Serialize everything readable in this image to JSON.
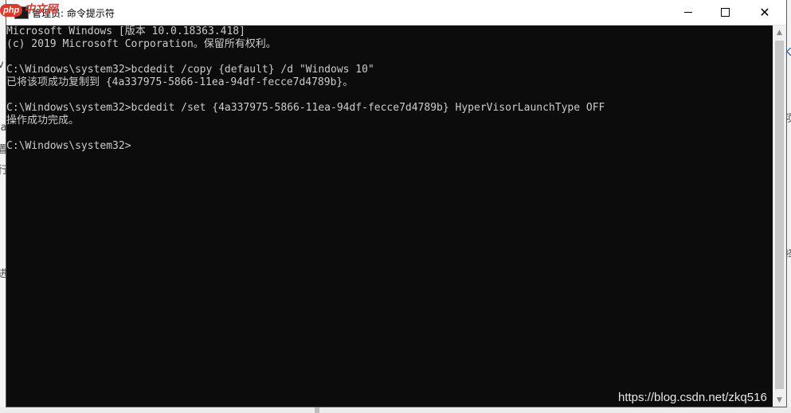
{
  "window": {
    "title": "管理员: 命令提示符",
    "badge_logo_text": "php",
    "badge_text": "中文网"
  },
  "controls": {
    "minimize_icon": "minimize-icon",
    "maximize_icon": "maximize-icon",
    "close_icon": "close-icon"
  },
  "console": {
    "lines": [
      "Microsoft Windows [版本 10.0.18363.418]",
      "(c) 2019 Microsoft Corporation。保留所有权利。",
      "",
      "C:\\Windows\\system32>bcdedit /copy {default} /d \"Windows 10\"",
      "已将该项成功复制到 {4a337975-5866-11ea-94df-fecce7d4789b}。",
      "",
      "C:\\Windows\\system32>bcdedit /set {4a337975-5866-11ea-94df-fecce7d4789b} HyperVisorLaunchType OFF",
      "操作成功完成。",
      "",
      "C:\\Windows\\system32>"
    ]
  },
  "background": {
    "left_fragments": [
      "v",
      "ia",
      "置",
      "行",
      "进"
    ],
    "right_fragments": [
      "Ki",
      "项",
      "择"
    ]
  },
  "watermark": "https://blog.csdn.net/zkq516"
}
